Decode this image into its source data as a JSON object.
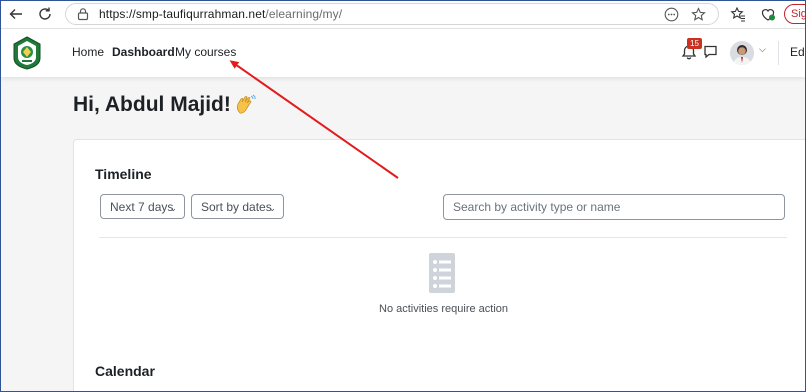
{
  "browser": {
    "url_host": "https://smp-taufiqurrahman.net",
    "url_path": "/elearning/my/",
    "signin_label": "Sign"
  },
  "navbar": {
    "home": "Home",
    "dashboard": "Dashboard",
    "my_courses": "My courses",
    "notification_count": "15",
    "edit_label": "Edi"
  },
  "page": {
    "greeting": "Hi, Abdul Majid!"
  },
  "timeline": {
    "title": "Timeline",
    "filter_label": "Next 7 days",
    "sort_label": "Sort by dates",
    "search_placeholder": "Search by activity type or name",
    "empty_message": "No activities require action"
  },
  "calendar": {
    "title": "Calendar"
  },
  "colors": {
    "annotation_arrow": "#e31b1b",
    "badge": "#ca3120",
    "signin": "#c4232b"
  }
}
